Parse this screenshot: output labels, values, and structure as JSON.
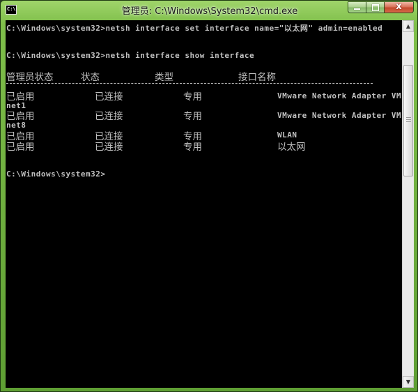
{
  "window": {
    "title": "管理员: C:\\Windows\\System32\\cmd.exe",
    "icon_text": "C:\\",
    "controls": {
      "minimize_icon": "minimize-icon",
      "maximize_icon": "maximize-icon",
      "close_icon": "close-icon",
      "close_glyph": "x"
    }
  },
  "console": {
    "lines": {
      "cmd1": "C:\\Windows\\system32>netsh interface set interface name=\"以太网\" admin=enabled",
      "cmd2": "C:\\Windows\\system32>netsh interface show interface",
      "prompt": "C:\\Windows\\system32>"
    },
    "headers": {
      "admin_state": "管理员状态",
      "state": "状态",
      "type": "类型",
      "name": "接口名称"
    },
    "rows": [
      {
        "admin_state": "已启用",
        "state": "已连接",
        "type": "专用",
        "name": "VMware Network Adapter VM",
        "name_cont": "net1"
      },
      {
        "admin_state": "已启用",
        "state": "已连接",
        "type": "专用",
        "name": "VMware Network Adapter VM",
        "name_cont": "net8"
      },
      {
        "admin_state": "已启用",
        "state": "已连接",
        "type": "专用",
        "name": "WLAN"
      },
      {
        "admin_state": "已启用",
        "state": "已连接",
        "type": "专用",
        "name": "以太网"
      }
    ]
  },
  "colors": {
    "console_bg": "#000000",
    "console_text": "#c0c0c0",
    "frame_green": "#7fbf4a"
  }
}
